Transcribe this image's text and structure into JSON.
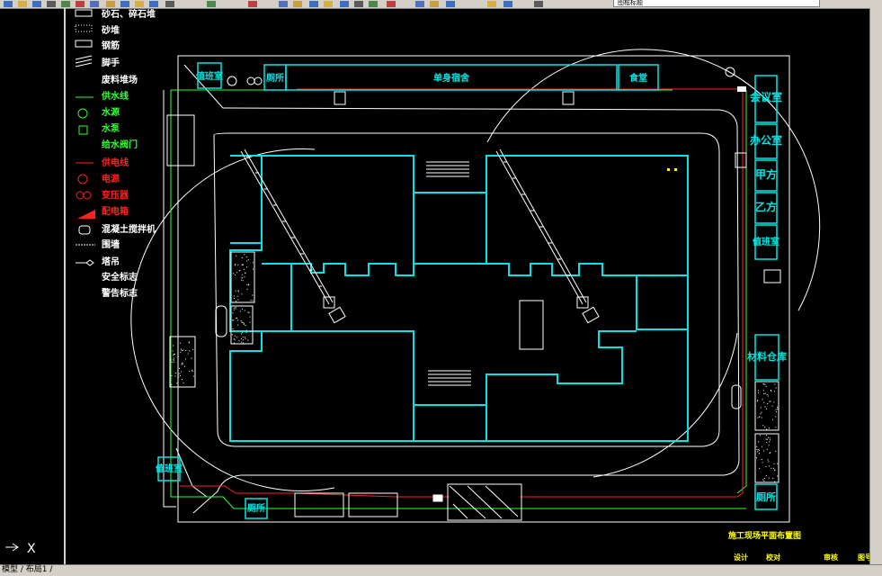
{
  "toolbar": {
    "layer_dropdown": "图框标题",
    "icons": [
      "new-icon",
      "open-icon",
      "save-icon",
      "print-icon",
      "preview-icon",
      "cut-icon",
      "copy-icon",
      "paste-icon",
      "match-icon",
      "undo-icon",
      "redo-icon",
      "pan-icon",
      "zoom-realtime-icon",
      "zoom-window-icon",
      "zoom-previous-icon",
      "properties-icon",
      "design-center-icon",
      "tool-palette-icon",
      "sheet-set-icon",
      "markup-icon",
      "calculator-icon",
      "help-icon",
      "layer-manager-icon",
      "layer-state-icon",
      "bulb-icon",
      "sun-icon",
      "lock-icon",
      "color-icon"
    ]
  },
  "legend": {
    "items": [
      {
        "label": "砂石、碎石堆",
        "color": "#ffffff"
      },
      {
        "label": "砂堆",
        "color": "#ffffff"
      },
      {
        "label": "钢筋",
        "color": "#ffffff"
      },
      {
        "label": "脚手",
        "color": "#ffffff"
      },
      {
        "label": "废料堆场",
        "color": "#ffffff"
      },
      {
        "label": "供水线",
        "color": "#33ff33"
      },
      {
        "label": "水源",
        "color": "#33ff33"
      },
      {
        "label": "水泵",
        "color": "#33ff33"
      },
      {
        "label": "给水阀门",
        "color": "#33ff33"
      },
      {
        "label": "供电线",
        "color": "#ff2020"
      },
      {
        "label": "电源",
        "color": "#ff2020"
      },
      {
        "label": "变压器",
        "color": "#ff2020"
      },
      {
        "label": "配电箱",
        "color": "#ff2020"
      },
      {
        "label": "混凝土搅拌机",
        "color": "#ffffff"
      },
      {
        "label": "围墙",
        "color": "#ffffff"
      },
      {
        "label": "塔吊",
        "color": "#ffffff"
      },
      {
        "label": "安全标志",
        "color": "#ffffff"
      },
      {
        "label": "警告标志",
        "color": "#ffffff"
      }
    ]
  },
  "plan": {
    "guard_room_top": "值班室",
    "toilet_top": "厕所",
    "dormitory": "单身宿舍",
    "canteen": "食堂",
    "meeting_room": "会议室",
    "office": "办公室",
    "party_a": "甲方",
    "party_b": "乙方",
    "guard_room_right": "值班室",
    "material_storage": "材料仓库",
    "toilet_right": "厕所",
    "guard_room_bottom": "值班室",
    "toilet_bottom": "厕所"
  },
  "title_block": {
    "line1": "施工现场平面布置图",
    "cells": [
      "设计",
      "校对",
      "审核",
      "图号"
    ]
  },
  "status": {
    "ucs_label": "X",
    "model_tabs": "模型 / 布局1 /"
  },
  "colors": {
    "background": "#000000",
    "building": "#00e5e5",
    "water": "#33ff33",
    "power": "#ff2020",
    "road": "#ffffff",
    "title": "#ffff00"
  }
}
